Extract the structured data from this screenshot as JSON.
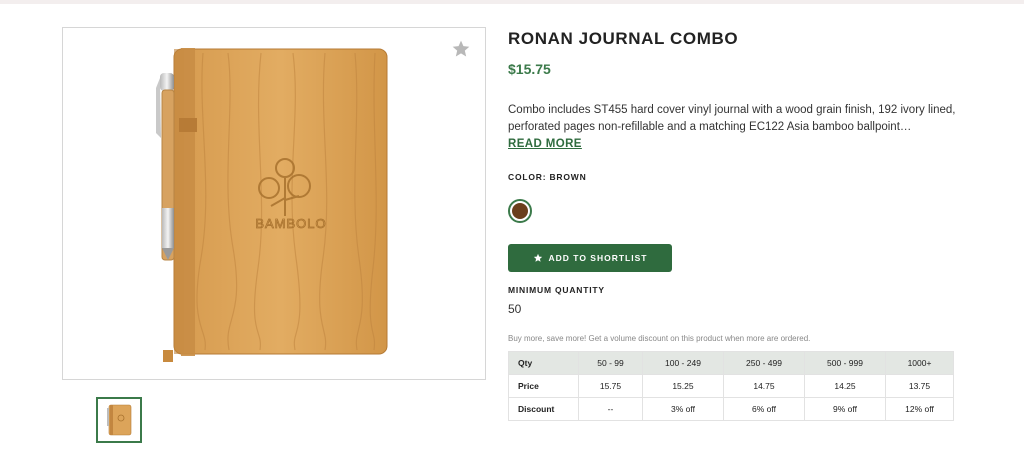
{
  "product": {
    "title": "RONAN JOURNAL COMBO",
    "price": "$15.75",
    "description": "Combo includes ST455 hard cover vinyl journal with a wood grain finish, 192 ivory lined, perforated pages non-refillable and a matching EC122 Asia bamboo ballpoint…",
    "read_more_label": "READ MORE",
    "color_label": "COLOR: BROWN",
    "selected_color": "#6b3f1c",
    "shortlist_label": "ADD TO SHORTLIST",
    "min_qty_label": "MINIMUM QUANTITY",
    "min_qty_value": "50",
    "volume_note": "Buy more, save more! Get a volume discount on this product when more are ordered.",
    "logo_text": "BAMBOLO"
  },
  "pricing_table": {
    "headers": [
      "Qty",
      "50 - 99",
      "100 - 249",
      "250 - 499",
      "500 - 999",
      "1000+"
    ],
    "rows": [
      [
        "Price",
        "15.75",
        "15.25",
        "14.75",
        "14.25",
        "13.75"
      ],
      [
        "Discount",
        "--",
        "3% off",
        "6% off",
        "9% off",
        "12% off"
      ]
    ]
  },
  "colors": {
    "accent": "#3b7a4a",
    "button": "#2f6b3e",
    "wood": "#d9a55a"
  },
  "icons": {
    "favorite": "star-icon",
    "shortlist": "star-icon"
  }
}
